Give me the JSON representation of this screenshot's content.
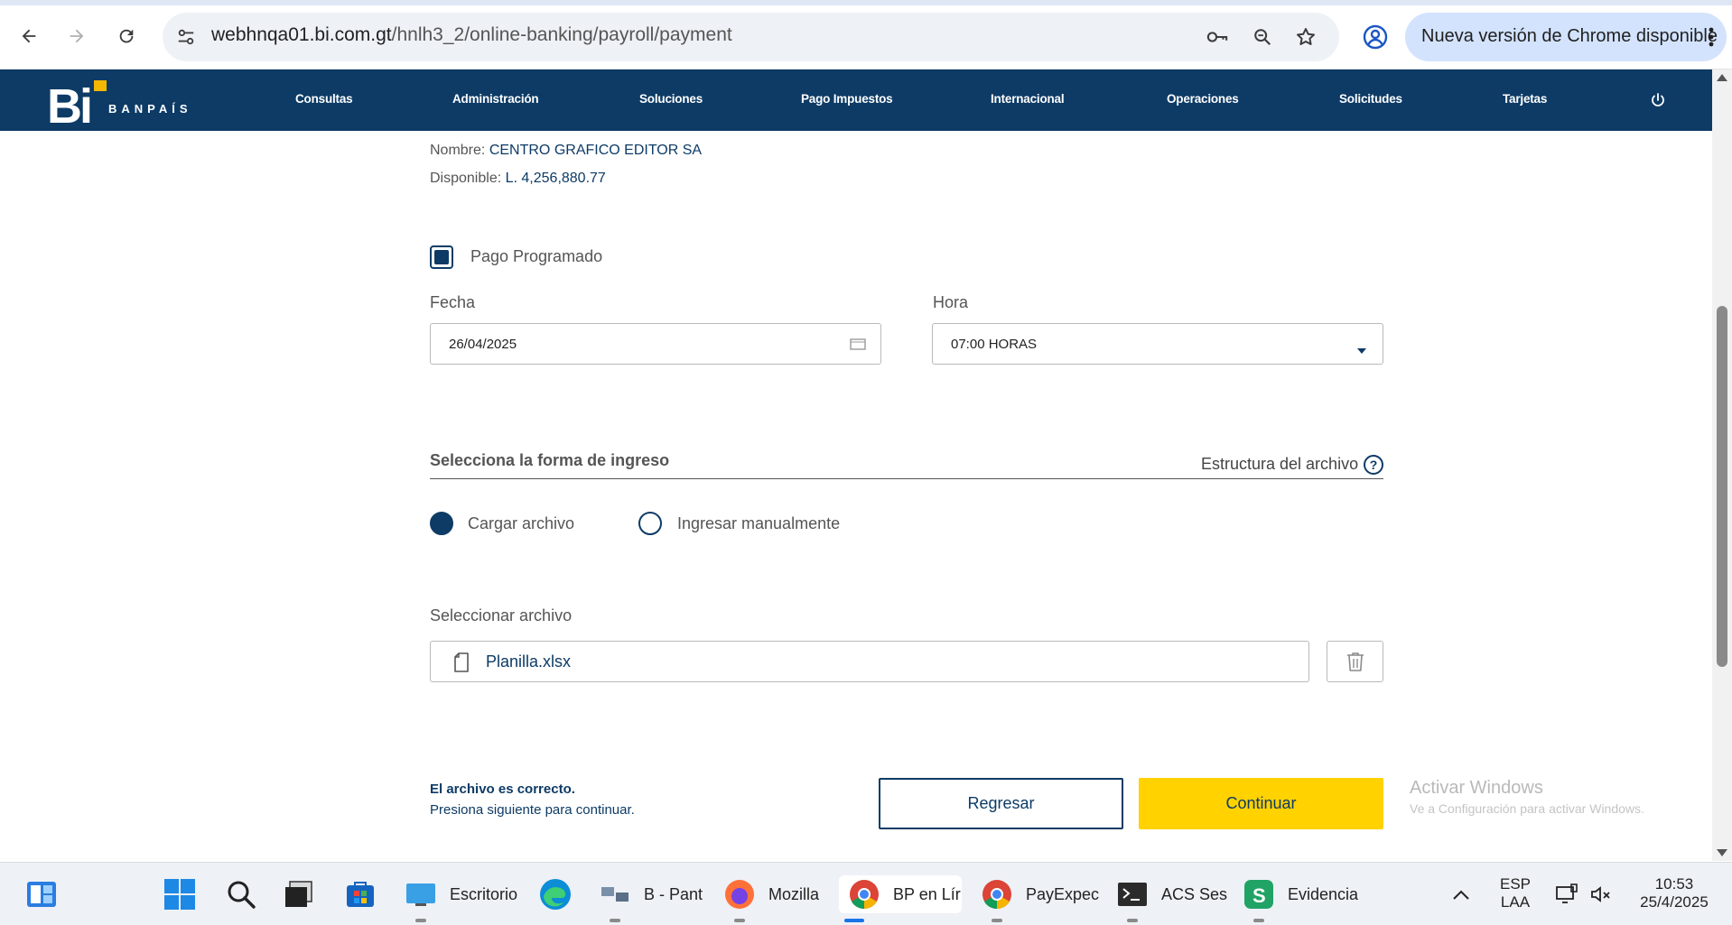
{
  "browser": {
    "url_host": "webhnqa01.bi.com.gt",
    "url_path": "/hnlh3_2/online-banking/payroll/payment",
    "update_label": "Nueva versión de Chrome disponible"
  },
  "bank_nav": {
    "logo_text": "Bi",
    "brand_name": "BANPAÍS",
    "items": [
      "Consultas",
      "Administración",
      "Soluciones",
      "Pago Impuestos",
      "Internacional",
      "Operaciones",
      "Solicitudes",
      "Tarjetas"
    ]
  },
  "account": {
    "name_label": "Nombre:",
    "name_value": "CENTRO GRAFICO EDITOR SA",
    "available_label": "Disponible:",
    "available_value": "L. 4,256,880.77"
  },
  "schedule": {
    "checkbox_label": "Pago Programado",
    "checked": true,
    "date_label": "Fecha",
    "date_value": "26/04/2025",
    "time_label": "Hora",
    "time_value": "07:00 HORAS"
  },
  "input_method": {
    "title": "Selecciona la forma de ingreso",
    "structure_link": "Estructura del archivo",
    "options": [
      "Cargar archivo",
      "Ingresar manualmente"
    ],
    "selected": "Cargar archivo"
  },
  "file": {
    "label": "Seleccionar archivo",
    "name": "Planilla.xlsx"
  },
  "status": {
    "line1": "El archivo es correcto.",
    "line2": "Presiona siguiente para continuar."
  },
  "actions": {
    "back_label": "Regresar",
    "continue_label": "Continuar"
  },
  "watermark": {
    "title": "Activar Windows",
    "subtitle": "Ve a Configuración para activar Windows."
  },
  "taskbar": {
    "apps": [
      {
        "label": "Escritorio"
      },
      {
        "label": "B - Pant"
      },
      {
        "label": "Mozilla"
      },
      {
        "label": "BP en Lír"
      },
      {
        "label": "PayExpec"
      },
      {
        "label": "ACS Ses"
      },
      {
        "label": "Evidencia"
      }
    ],
    "lang_top": "ESP",
    "lang_bottom": "LAA",
    "time": "10:53",
    "date": "25/4/2025"
  },
  "colors": {
    "brand_navy": "#0d3b66",
    "brand_yellow": "#ffd200",
    "accent_gold": "#f5b800"
  }
}
